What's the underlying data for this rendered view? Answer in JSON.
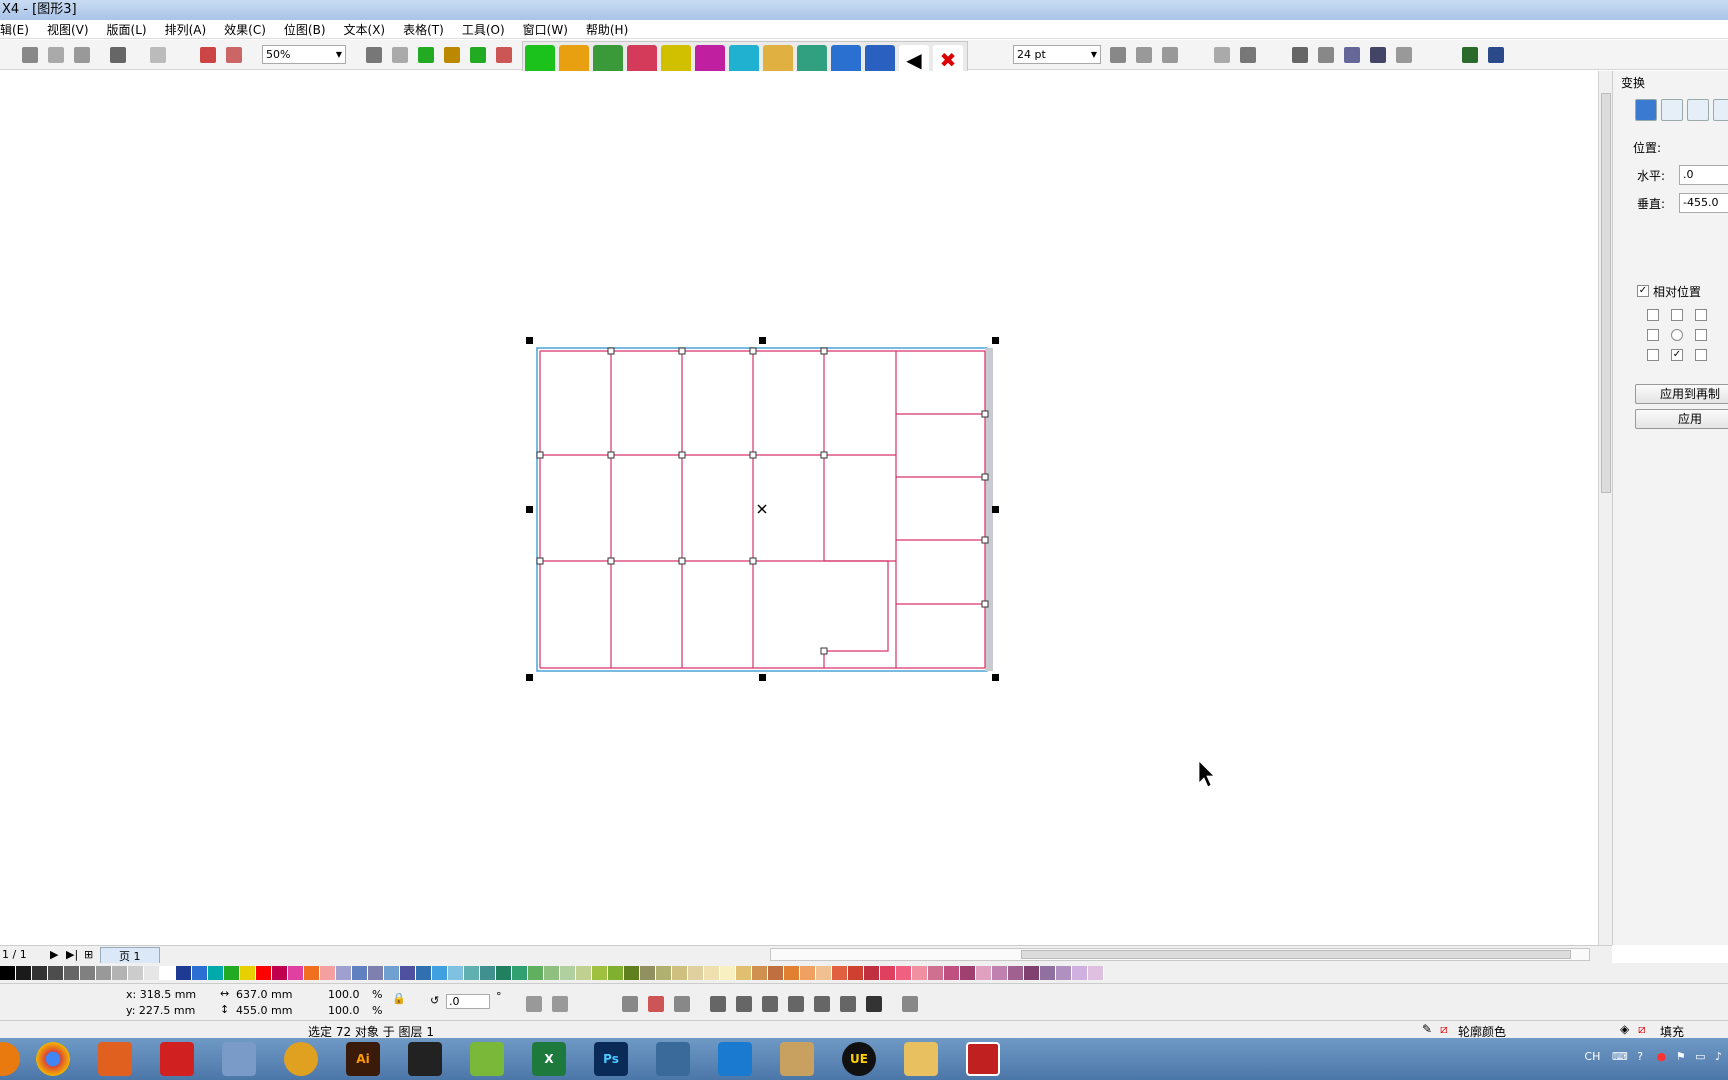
{
  "window": {
    "title": "X4 - [图形3]"
  },
  "menu": [
    "辑(E)",
    "视图(V)",
    "版面(L)",
    "排列(A)",
    "效果(C)",
    "位图(B)",
    "文本(X)",
    "表格(T)",
    "工具(O)",
    "窗口(W)",
    "帮助(H)"
  ],
  "toolbar": {
    "zoom": "50%",
    "font_size": "24 pt"
  },
  "transform_panel": {
    "title": "变换",
    "position_label": "位置:",
    "horizontal_label": "水平:",
    "horizontal_value": ".0",
    "vertical_label": "垂直:",
    "vertical_value": "-455.0",
    "relative_label": "相对位置",
    "apply_copy": "应用到再制",
    "apply": "应用"
  },
  "pages": {
    "counter": "1 / 1",
    "tab": "页 1"
  },
  "properties": {
    "x": "x: 318.5 mm",
    "y": "y: 227.5 mm",
    "w": "637.0 mm",
    "h": "455.0 mm",
    "scale_x": "100.0",
    "scale_y": "100.0",
    "pct": "%",
    "rotation": ".0",
    "deg": "°"
  },
  "status": {
    "selection": "选定 72 对象 于 图层 1",
    "outline": "轮廓颜色",
    "fill": "填充"
  },
  "tray": {
    "lang": "CH"
  },
  "colors": {
    "grid_line": "#d6336c",
    "bbox": "#4aa3d8"
  }
}
